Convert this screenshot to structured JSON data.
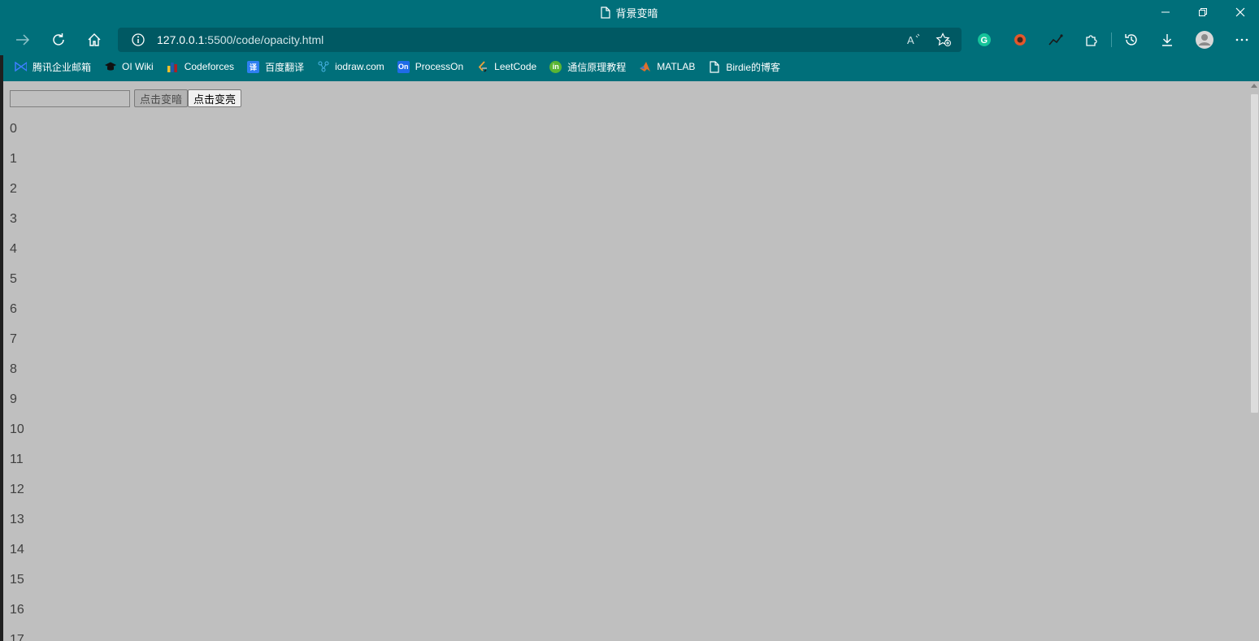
{
  "window": {
    "title": "背景变暗"
  },
  "address_bar": {
    "url_host": "127.0.0.1",
    "url_rest": ":5500/code/opacity.html"
  },
  "bookmarks": [
    {
      "label": "腾讯企业邮箱",
      "icon": "tencent-mail-icon",
      "color": "#3d7fff"
    },
    {
      "label": "OI Wiki",
      "icon": "graduation-cap-icon",
      "color": "#111111"
    },
    {
      "label": "Codeforces",
      "icon": "codeforces-bars-icon",
      "color": "#f3c12b"
    },
    {
      "label": "百度翻译",
      "icon": "baidu-translate-icon",
      "color": "#2e7ff2"
    },
    {
      "label": "iodraw.com",
      "icon": "iodraw-icon",
      "color": "#49b4e6"
    },
    {
      "label": "ProcessOn",
      "icon": "processon-icon",
      "color": "#1f6be8"
    },
    {
      "label": "LeetCode",
      "icon": "leetcode-icon",
      "color": "#f0a33a"
    },
    {
      "label": "通信原理教程",
      "icon": "course-icon",
      "color": "#5ab534"
    },
    {
      "label": "MATLAB",
      "icon": "matlab-icon",
      "color": "#e0702c"
    },
    {
      "label": "Birdie的博客",
      "icon": "page-icon",
      "color": "#ffffff"
    }
  ],
  "page": {
    "input_value": "",
    "dark_button": "点击变暗",
    "light_button": "点击变亮",
    "numbers": [
      "0",
      "1",
      "2",
      "3",
      "4",
      "5",
      "6",
      "7",
      "8",
      "9",
      "10",
      "11",
      "12",
      "13",
      "14",
      "15",
      "16",
      "17"
    ]
  }
}
